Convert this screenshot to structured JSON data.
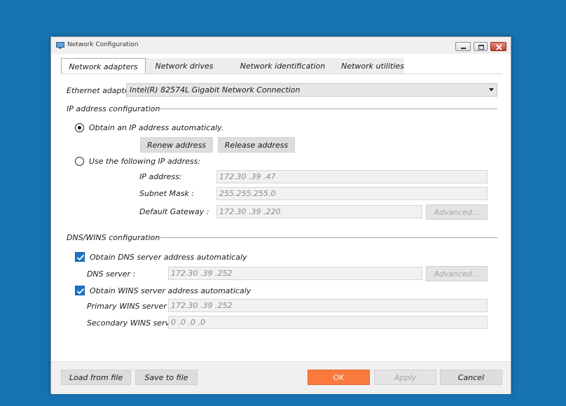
{
  "window": {
    "title": "Network Configuration"
  },
  "tabs": [
    {
      "label": "Network adapters"
    },
    {
      "label": "Network drives"
    },
    {
      "label": "Network identification"
    },
    {
      "label": "Network utilities"
    }
  ],
  "adapter": {
    "label": "Ethernet adapter:",
    "value": "Intel(R) 82574L Gigabit Network Connection"
  },
  "ip_config": {
    "section_title": "IP address configuration",
    "auto_radio_label": "Obtain an IP address automaticaly.",
    "auto_selected": true,
    "renew_label": "Renew address",
    "release_label": "Release address",
    "manual_radio_label": "Use the following IP address:",
    "ip_label": "IP address:",
    "ip_value": "172.30 .39 .47",
    "mask_label": "Subnet Mask :",
    "mask_value": "255.255.255.0",
    "gateway_label": "Default Gateway :",
    "gateway_value": "172.30 .39 .220",
    "advanced_label": "Advanced..."
  },
  "dns_config": {
    "section_title": "DNS/WINS configuration",
    "dns_auto_label": "Obtain DNS server address automaticaly",
    "dns_server_label": "DNS server :",
    "dns_server_value": "172.30 .39 .252",
    "advanced_label": "Advanced...",
    "wins_auto_label": "Obtain WINS server address automaticaly",
    "primary_wins_label": "Primary WINS server :",
    "primary_wins_value": "172.30 .39 .252",
    "secondary_wins_label": "Secondary WINS server:",
    "secondary_wins_value": "0  .0  .0  .0"
  },
  "footer": {
    "load_label": "Load from file",
    "save_label": "Save to file",
    "ok_label": "OK",
    "apply_label": "Apply",
    "cancel_label": "Cancel"
  },
  "colors": {
    "desktop": "#1673b1",
    "ok_button": "#fa7a3e",
    "checkbox": "#1b74c9"
  }
}
